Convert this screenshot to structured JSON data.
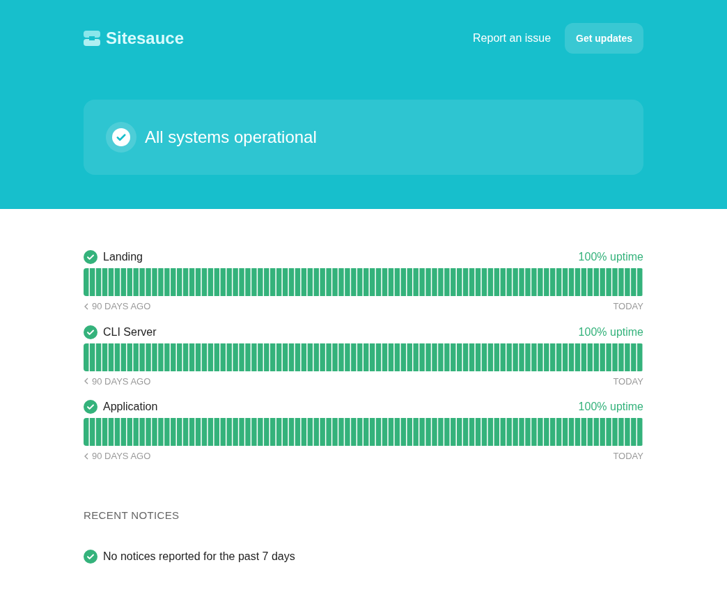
{
  "brand": {
    "name": "Sitesauce"
  },
  "nav": {
    "link": "Report an issue",
    "button": "Get updates"
  },
  "banner": {
    "operational": true,
    "text": "All systems operational"
  },
  "services": [
    {
      "name": "Landing",
      "operational": true,
      "uptime": "100% uptime",
      "start": "90 DAYS AGO",
      "end": "TODAY"
    },
    {
      "name": "CLI Server",
      "operational": true,
      "uptime": "100% uptime",
      "start": "90 DAYS AGO",
      "end": "TODAY"
    },
    {
      "name": "Application",
      "operational": true,
      "uptime": "100% uptime",
      "start": "90 DAYS AGO",
      "end": "TODAY"
    }
  ],
  "notices": {
    "heading": "RECENT NOTICES",
    "operational": true,
    "text": "No notices reported for the past 7 days"
  }
}
